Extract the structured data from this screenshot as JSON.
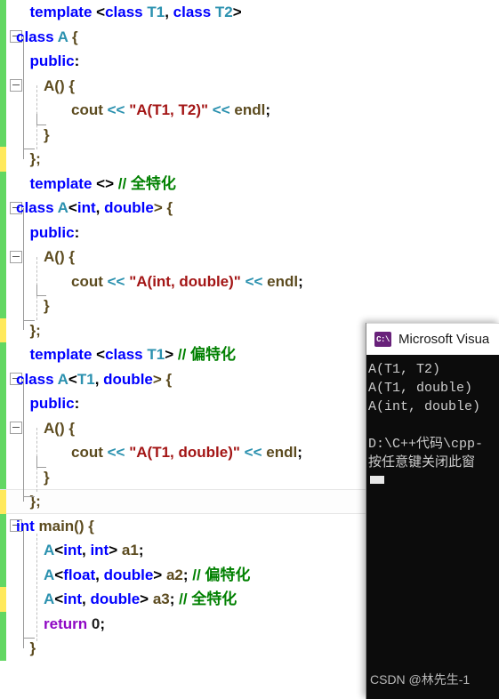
{
  "editor": {
    "lines": [
      {
        "indent": 2,
        "change": "saved",
        "fold": false,
        "tokens": [
          {
            "t": "template ",
            "c": "k"
          },
          {
            "t": "<",
            "c": "pl"
          },
          {
            "t": "class ",
            "c": "k"
          },
          {
            "t": "T1",
            "c": "ty"
          },
          {
            "t": ", ",
            "c": "pl"
          },
          {
            "t": "class ",
            "c": "k"
          },
          {
            "t": "T2",
            "c": "ty"
          },
          {
            "t": ">",
            "c": "pl"
          }
        ]
      },
      {
        "indent": 1,
        "change": "saved",
        "fold": true,
        "tokens": [
          {
            "t": "class ",
            "c": "k"
          },
          {
            "t": "A",
            "c": "ty"
          },
          {
            "t": " {",
            "c": "id"
          }
        ]
      },
      {
        "indent": 2,
        "change": "saved",
        "fold": false,
        "tokens": [
          {
            "t": "public",
            "c": "k"
          },
          {
            "t": ":",
            "c": "pl"
          }
        ]
      },
      {
        "indent": 3,
        "change": "saved",
        "fold": true,
        "tokens": [
          {
            "t": "A() {",
            "c": "id"
          }
        ]
      },
      {
        "indent": 5,
        "change": "saved",
        "fold": false,
        "tokens": [
          {
            "t": "cout ",
            "c": "id"
          },
          {
            "t": "<< ",
            "c": "op"
          },
          {
            "t": "\"A(T1, T2)\"",
            "c": "str"
          },
          {
            "t": " << ",
            "c": "op"
          },
          {
            "t": "endl",
            "c": "id"
          },
          {
            "t": ";",
            "c": "pl"
          }
        ]
      },
      {
        "indent": 3,
        "change": "saved",
        "fold": false,
        "tokens": [
          {
            "t": "}",
            "c": "id"
          }
        ]
      },
      {
        "indent": 2,
        "change": "unsaved",
        "fold": false,
        "tokens": [
          {
            "t": "};",
            "c": "id"
          }
        ]
      },
      {
        "indent": 2,
        "change": "saved",
        "fold": false,
        "tokens": [
          {
            "t": "template ",
            "c": "k"
          },
          {
            "t": "<> ",
            "c": "pl"
          },
          {
            "t": "// 全特化",
            "c": "cm"
          }
        ]
      },
      {
        "indent": 1,
        "change": "saved",
        "fold": true,
        "tokens": [
          {
            "t": "class ",
            "c": "k"
          },
          {
            "t": "A",
            "c": "ty"
          },
          {
            "t": "<",
            "c": "pl"
          },
          {
            "t": "int",
            "c": "k"
          },
          {
            "t": ", ",
            "c": "pl"
          },
          {
            "t": "double",
            "c": "k"
          },
          {
            "t": "> {",
            "c": "id"
          }
        ]
      },
      {
        "indent": 2,
        "change": "saved",
        "fold": false,
        "tokens": [
          {
            "t": "public",
            "c": "k"
          },
          {
            "t": ":",
            "c": "pl"
          }
        ]
      },
      {
        "indent": 3,
        "change": "saved",
        "fold": true,
        "tokens": [
          {
            "t": "A() {",
            "c": "id"
          }
        ]
      },
      {
        "indent": 5,
        "change": "saved",
        "fold": false,
        "tokens": [
          {
            "t": "cout ",
            "c": "id"
          },
          {
            "t": "<< ",
            "c": "op"
          },
          {
            "t": "\"A(int, double)\"",
            "c": "str"
          },
          {
            "t": " << ",
            "c": "op"
          },
          {
            "t": "endl",
            "c": "id"
          },
          {
            "t": ";",
            "c": "pl"
          }
        ]
      },
      {
        "indent": 3,
        "change": "saved",
        "fold": false,
        "tokens": [
          {
            "t": "}",
            "c": "id"
          }
        ]
      },
      {
        "indent": 2,
        "change": "unsaved",
        "fold": false,
        "tokens": [
          {
            "t": "};",
            "c": "id"
          }
        ]
      },
      {
        "indent": 2,
        "change": "saved",
        "fold": false,
        "tokens": [
          {
            "t": "template ",
            "c": "k"
          },
          {
            "t": "<",
            "c": "pl"
          },
          {
            "t": "class ",
            "c": "k"
          },
          {
            "t": "T1",
            "c": "ty"
          },
          {
            "t": "> ",
            "c": "pl"
          },
          {
            "t": "// 偏特化",
            "c": "cm"
          }
        ]
      },
      {
        "indent": 1,
        "change": "saved",
        "fold": true,
        "tokens": [
          {
            "t": "class ",
            "c": "k"
          },
          {
            "t": "A",
            "c": "ty"
          },
          {
            "t": "<",
            "c": "pl"
          },
          {
            "t": "T1",
            "c": "ty"
          },
          {
            "t": ", ",
            "c": "pl"
          },
          {
            "t": "double",
            "c": "k"
          },
          {
            "t": "> {",
            "c": "id"
          }
        ]
      },
      {
        "indent": 2,
        "change": "saved",
        "fold": false,
        "tokens": [
          {
            "t": "public",
            "c": "k"
          },
          {
            "t": ":",
            "c": "pl"
          }
        ]
      },
      {
        "indent": 3,
        "change": "saved",
        "fold": true,
        "tokens": [
          {
            "t": "A() {",
            "c": "id"
          }
        ]
      },
      {
        "indent": 5,
        "change": "saved",
        "fold": false,
        "tokens": [
          {
            "t": "cout ",
            "c": "id"
          },
          {
            "t": "<< ",
            "c": "op"
          },
          {
            "t": "\"A(T1, double)\"",
            "c": "str"
          },
          {
            "t": " << ",
            "c": "op"
          },
          {
            "t": "endl",
            "c": "id"
          },
          {
            "t": ";",
            "c": "pl"
          }
        ]
      },
      {
        "indent": 3,
        "change": "saved",
        "fold": false,
        "tokens": [
          {
            "t": "}",
            "c": "id"
          }
        ]
      },
      {
        "indent": 2,
        "change": "unsaved",
        "fold": false,
        "current": true,
        "tokens": [
          {
            "t": "};",
            "c": "id"
          }
        ]
      },
      {
        "indent": 1,
        "change": "saved",
        "fold": true,
        "tokens": [
          {
            "t": "int ",
            "c": "k"
          },
          {
            "t": "main() {",
            "c": "id"
          }
        ]
      },
      {
        "indent": 3,
        "change": "saved",
        "fold": false,
        "tokens": [
          {
            "t": "A",
            "c": "ty"
          },
          {
            "t": "<",
            "c": "pl"
          },
          {
            "t": "int",
            "c": "k"
          },
          {
            "t": ", ",
            "c": "pl"
          },
          {
            "t": "int",
            "c": "k"
          },
          {
            "t": "> ",
            "c": "pl"
          },
          {
            "t": "a1",
            "c": "id"
          },
          {
            "t": ";",
            "c": "pl"
          }
        ]
      },
      {
        "indent": 3,
        "change": "saved",
        "fold": false,
        "tokens": [
          {
            "t": "A",
            "c": "ty"
          },
          {
            "t": "<",
            "c": "pl"
          },
          {
            "t": "float",
            "c": "k"
          },
          {
            "t": ", ",
            "c": "pl"
          },
          {
            "t": "double",
            "c": "k"
          },
          {
            "t": "> ",
            "c": "pl"
          },
          {
            "t": "a2",
            "c": "id"
          },
          {
            "t": "; ",
            "c": "pl"
          },
          {
            "t": "// 偏特化",
            "c": "cm"
          }
        ]
      },
      {
        "indent": 3,
        "change": "unsaved",
        "fold": false,
        "tokens": [
          {
            "t": "A",
            "c": "ty"
          },
          {
            "t": "<",
            "c": "pl"
          },
          {
            "t": "int",
            "c": "k"
          },
          {
            "t": ", ",
            "c": "pl"
          },
          {
            "t": "double",
            "c": "k"
          },
          {
            "t": "> ",
            "c": "pl"
          },
          {
            "t": "a3",
            "c": "id"
          },
          {
            "t": "; ",
            "c": "pl"
          },
          {
            "t": "// 全特化",
            "c": "cm"
          }
        ]
      },
      {
        "indent": 3,
        "change": "saved",
        "fold": false,
        "tokens": [
          {
            "t": "return ",
            "c": "rt"
          },
          {
            "t": "0",
            "c": "num"
          },
          {
            "t": ";",
            "c": "pl"
          }
        ]
      },
      {
        "indent": 2,
        "change": "saved",
        "fold": false,
        "tokens": [
          {
            "t": "}",
            "c": "id"
          }
        ]
      }
    ]
  },
  "console": {
    "icon": "console-icon",
    "title": "Microsoft Visua",
    "output": [
      "A(T1, T2)",
      "A(T1, double)",
      "A(int, double)",
      "",
      "D:\\C++代码\\cpp-",
      "按任意键关闭此窗"
    ],
    "watermark": "CSDN @林先生-1"
  },
  "colors": {
    "keyword": "#0000ff",
    "type": "#2b91af",
    "string": "#a31515",
    "comment": "#008000",
    "identifier": "#5c4b1f",
    "return_keyword": "#8f08c4",
    "change_saved": "#62d762",
    "change_unsaved": "#ffe95c",
    "console_bg": "#0c0c0c",
    "console_text": "#cccccc",
    "console_icon_bg": "#68217a"
  }
}
